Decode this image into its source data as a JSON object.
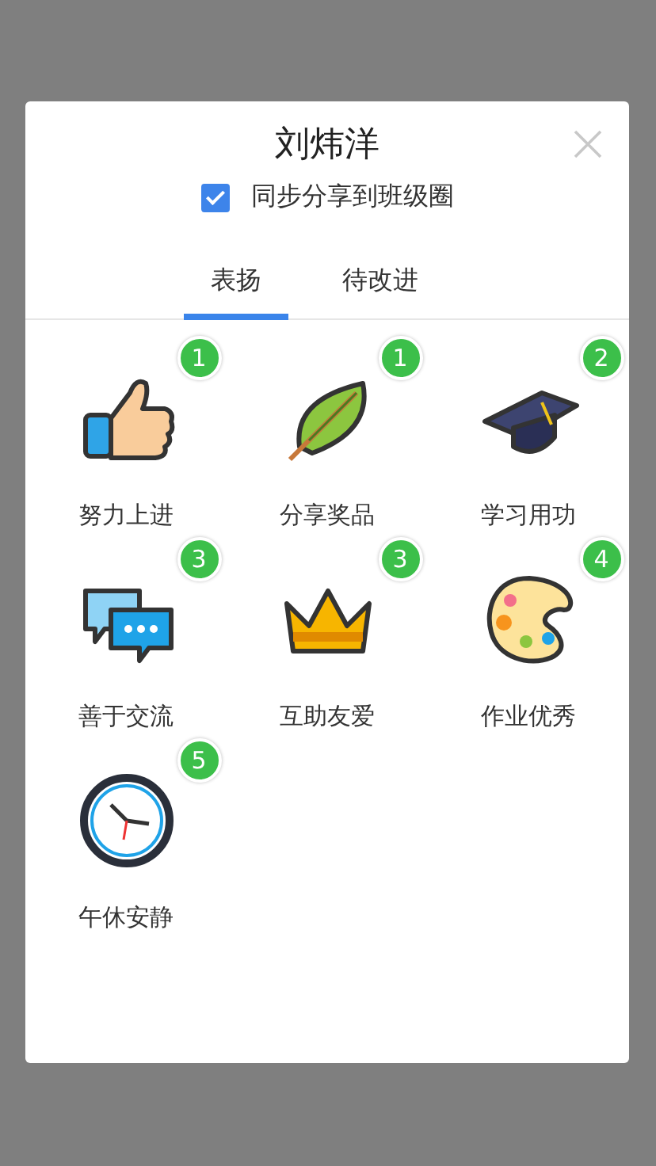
{
  "dialog": {
    "title": "刘炜洋",
    "share": {
      "label": "同步分享到班级圈",
      "checked": true
    },
    "tabs": [
      {
        "label": "表扬",
        "selected": true
      },
      {
        "label": "待改进",
        "selected": false
      }
    ],
    "items": [
      {
        "kind": "thumb",
        "label": "努力上进",
        "count": "1"
      },
      {
        "kind": "leaf",
        "label": "分享奖品",
        "count": "1"
      },
      {
        "kind": "cap",
        "label": "学习用功",
        "count": "2"
      },
      {
        "kind": "chat",
        "label": "善于交流",
        "count": "3"
      },
      {
        "kind": "crown",
        "label": "互助友爱",
        "count": "3"
      },
      {
        "kind": "palette",
        "label": "作业优秀",
        "count": "4"
      },
      {
        "kind": "clock",
        "label": "午休安静",
        "count": "5"
      }
    ]
  }
}
